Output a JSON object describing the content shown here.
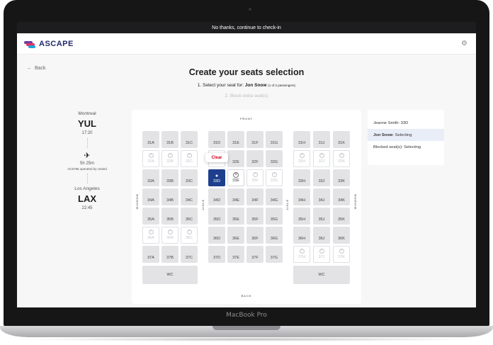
{
  "device": {
    "label": "MacBook Pro"
  },
  "topbar": {
    "text": "No thanks, continue to check-in"
  },
  "header": {
    "brand": "ASCAPE",
    "brand_colors": [
      "#6b3fa0",
      "#e8315f",
      "#1fa2d9"
    ]
  },
  "nav": {
    "back_label": "Back"
  },
  "page": {
    "title": "Create your seats selection",
    "step1_prefix": "1. Select your seat for: ",
    "step1_name": "Jon Snow",
    "step1_count": "(1 of 2 passengers)",
    "step2": "2. Block extra seat(s)"
  },
  "flight": {
    "origin_city": "Montreal",
    "origin_code": "YUL",
    "depart_time": "17:20",
    "duration": "5h 25m",
    "operator": "AC5796 operated by United",
    "dest_city": "Los Angeles",
    "dest_code": "LAX",
    "arrive_time": "22:45"
  },
  "seatmap": {
    "front_label": "FRONT",
    "back_label": "BACK",
    "window_label": "WINDOW",
    "aisle_label": "AISLE",
    "wc_label": "WC",
    "clear_label": "Clear",
    "selected_color": "#1e3f8e",
    "rows": [
      "31",
      "32",
      "33",
      "34",
      "35",
      "36",
      "37"
    ],
    "columns": [
      "A",
      "B",
      "C",
      "D",
      "E",
      "F",
      "G",
      "H",
      "J",
      "K"
    ],
    "blocked": [
      "32A",
      "32B",
      "32C",
      "32H",
      "32J",
      "32K",
      "33F",
      "33G",
      "36A",
      "36B",
      "36C",
      "37H",
      "37J",
      "37K"
    ],
    "occupied": [
      "32D"
    ],
    "selected": "33D",
    "addable": [
      "33E"
    ]
  },
  "passengers": [
    {
      "name": "Jeanne Smith",
      "status": "33D",
      "active": false
    },
    {
      "name": "Jon Snow",
      "status": "Selecting",
      "active": true
    },
    {
      "name": "Blocked seat(s)",
      "status": "Selecting",
      "active": false
    }
  ]
}
